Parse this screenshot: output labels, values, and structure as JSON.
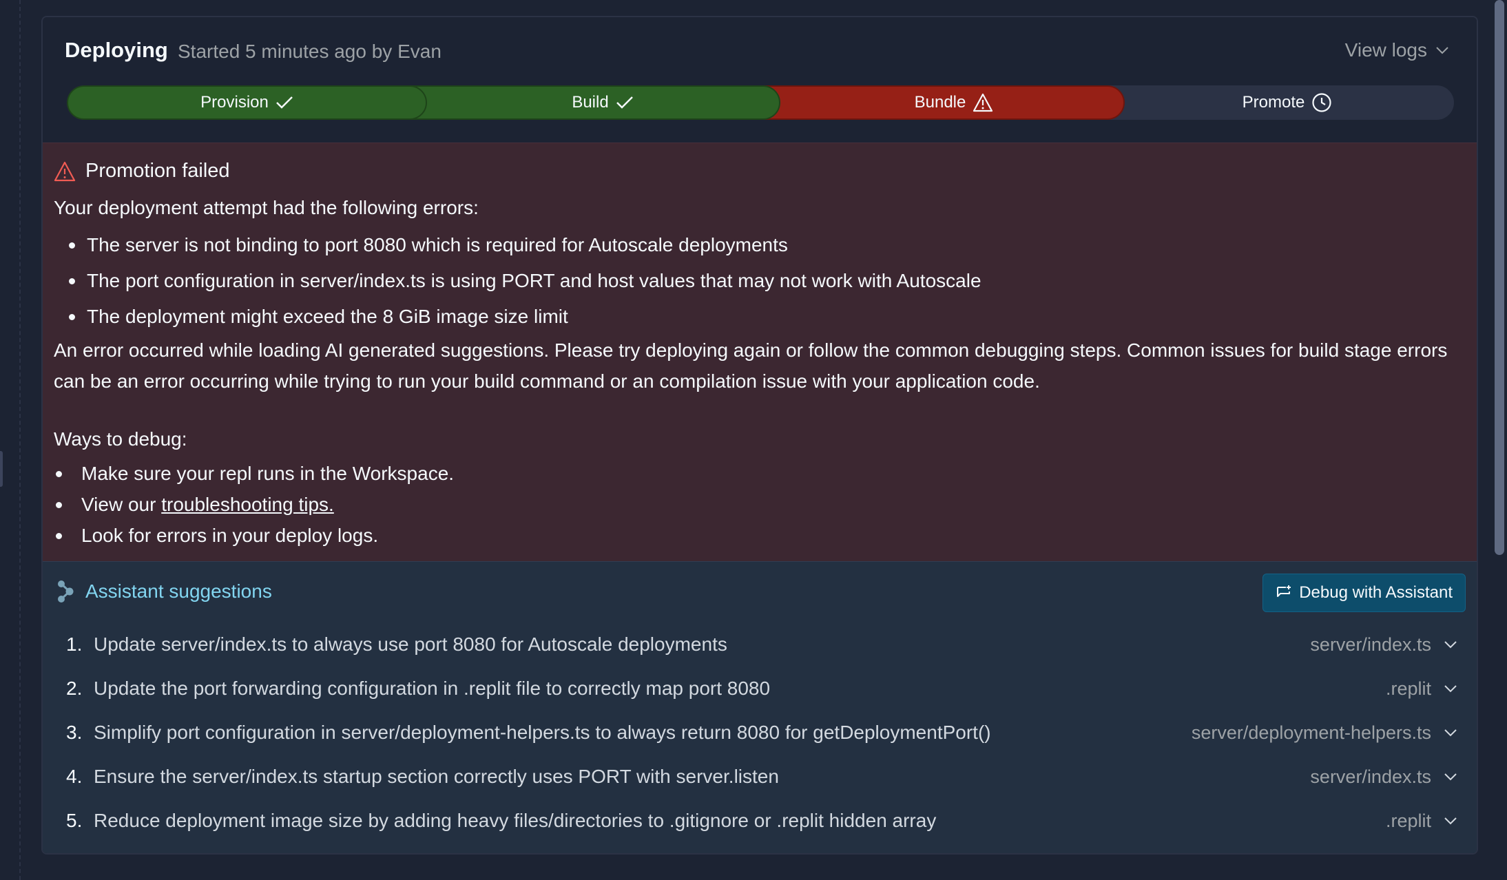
{
  "header": {
    "title": "Deploying",
    "subtitle": "Started 5 minutes ago by Evan",
    "view_logs": "View logs"
  },
  "steps": [
    {
      "label": "Provision",
      "status": "success",
      "icon": "check-icon"
    },
    {
      "label": "Build",
      "status": "success",
      "icon": "check-icon"
    },
    {
      "label": "Bundle",
      "status": "failed",
      "icon": "warning-icon"
    },
    {
      "label": "Promote",
      "status": "pending",
      "icon": "clock-icon"
    }
  ],
  "error": {
    "title": "Promotion failed",
    "intro": "Your deployment attempt had the following errors:",
    "items": [
      "The server is not binding to port 8080 which is required for Autoscale deployments",
      "The port configuration in server/index.ts is using PORT and host values that may not work with Autoscale",
      "The deployment might exceed the 8 GiB image size limit"
    ],
    "paragraph": "An error occurred while loading AI generated suggestions. Please try deploying again or follow the common debugging steps. Common issues for build stage errors can be an error occurring while trying to run your build command or an compilation issue with your application code.",
    "ways_title": "Ways to debug:",
    "ways": {
      "item1": "Make sure your repl runs in the Workspace.",
      "item2_prefix": "View our ",
      "item2_link": "troubleshooting tips.",
      "item3": "Look for errors in your deploy logs."
    }
  },
  "assistant": {
    "title": "Assistant suggestions",
    "debug_button": "Debug with Assistant",
    "suggestions": [
      {
        "num": "1.",
        "text": "Update server/index.ts to always use port 8080 for Autoscale deployments",
        "file": "server/index.ts"
      },
      {
        "num": "2.",
        "text": "Update the port forwarding configuration in .replit file to correctly map port 8080",
        "file": ".replit"
      },
      {
        "num": "3.",
        "text": "Simplify port configuration in server/deployment-helpers.ts to always return 8080 for getDeploymentPort()",
        "file": "server/deployment-helpers.ts"
      },
      {
        "num": "4.",
        "text": "Ensure the server/index.ts startup section correctly uses PORT with server.listen",
        "file": "server/index.ts"
      },
      {
        "num": "5.",
        "text": "Reduce deployment image size by adding heavy files/directories to .gitignore or .replit hidden array",
        "file": ".replit"
      }
    ]
  },
  "colors": {
    "success": "#2c6125",
    "failed": "#962016",
    "error_bg": "#3c2731",
    "assistant_accent": "#82d5f0",
    "button_bg": "#0d4d6b"
  }
}
